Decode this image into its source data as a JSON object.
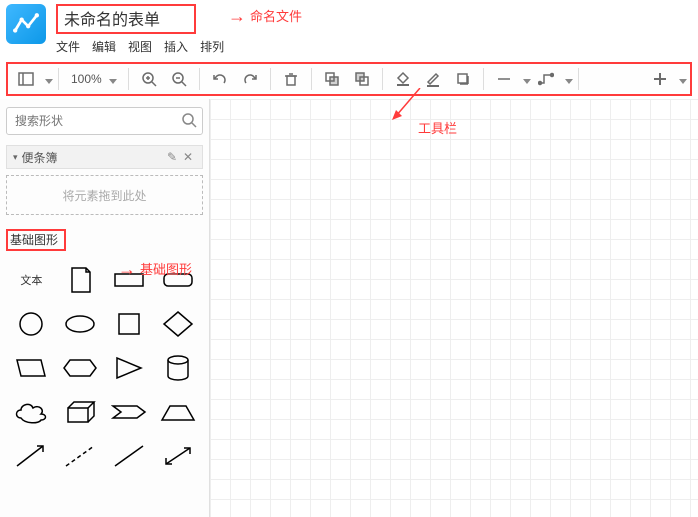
{
  "app": {
    "title": "未命名的表单"
  },
  "menu": {
    "file": "文件",
    "edit": "编辑",
    "view": "视图",
    "insert": "插入",
    "arrange": "排列"
  },
  "toolbar": {
    "zoom": "100%"
  },
  "sidebar": {
    "search_placeholder": "搜索形状",
    "scratchpad": {
      "title": "便条簿",
      "dropzone": "将元素拖到此处"
    },
    "basic_shapes": {
      "title": "基础图形",
      "text_label": "文本"
    }
  },
  "annotations": {
    "rename_file": "命名文件",
    "toolbar": "工具栏",
    "basic_shapes": "基础图形"
  }
}
